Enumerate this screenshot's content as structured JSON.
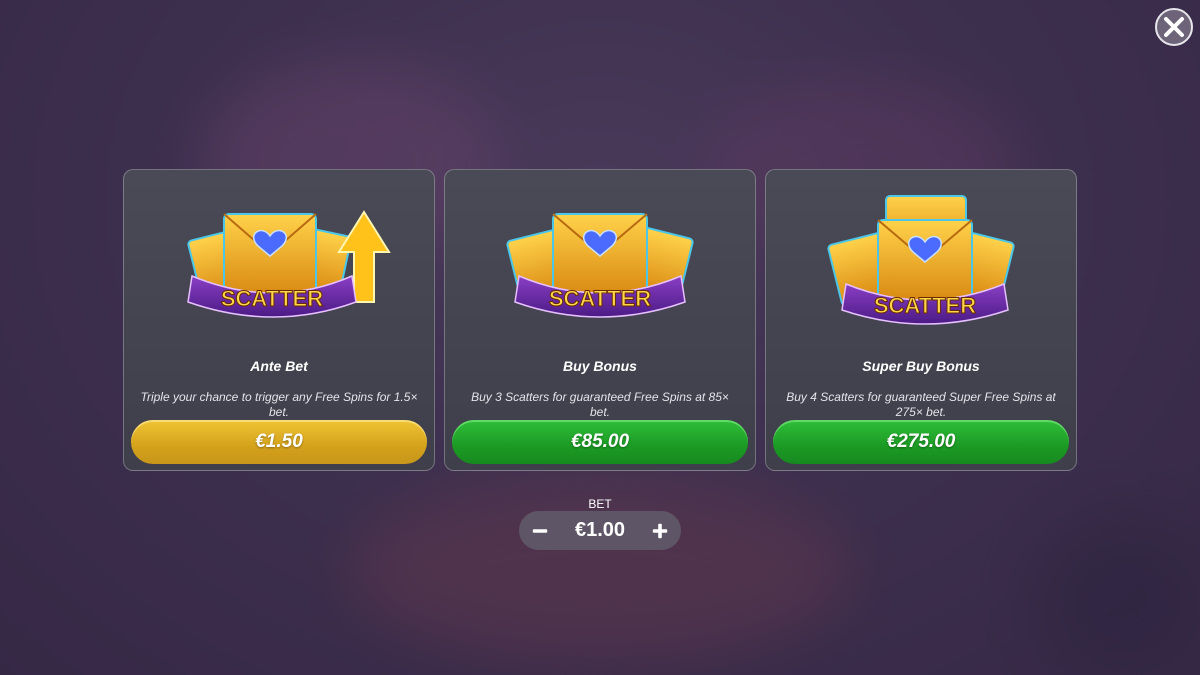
{
  "close": {
    "icon": "close-icon"
  },
  "cards": [
    {
      "title": "Ante Bet",
      "description": "Triple your chance to trigger any Free Spins for 1.5× bet.",
      "price": "€1.50",
      "button_color": "#d4a21b",
      "art_label": "SCATTER",
      "art": "scatter-envelopes-with-arrow-icon"
    },
    {
      "title": "Buy Bonus",
      "description": "Buy 3 Scatters for guaranteed Free Spins at 85× bet.",
      "price": "€85.00",
      "button_color": "#1c9a24",
      "art_label": "SCATTER",
      "art": "scatter-three-envelopes-icon"
    },
    {
      "title": "Super Buy Bonus",
      "description": "Buy 4 Scatters for guaranteed Super Free Spins at 275× bet.",
      "price": "€275.00",
      "button_color": "#1c9a24",
      "art_label": "SCATTER",
      "art": "scatter-four-envelopes-icon"
    }
  ],
  "bet": {
    "label": "BET",
    "value": "€1.00",
    "decrease_icon": "minus-icon",
    "increase_icon": "plus-icon"
  }
}
